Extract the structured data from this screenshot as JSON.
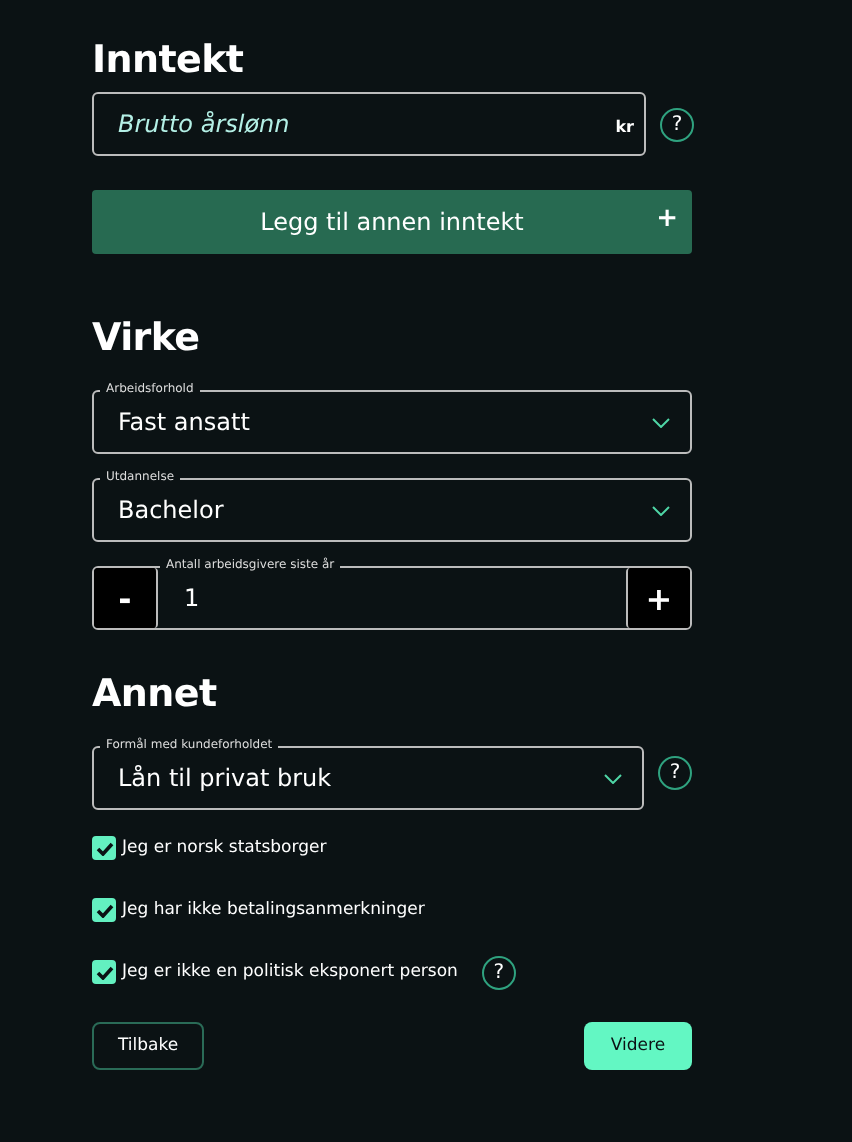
{
  "sections": [
    {
      "heading": "Inntekt",
      "fields": [
        {
          "kind": "input",
          "placeholder": "Brutto årslønn",
          "suffix": "kr",
          "help": "?"
        },
        {
          "kind": "add",
          "label": "Legg til annen inntekt",
          "icon": "+"
        }
      ]
    },
    {
      "heading": "Virke",
      "fields": [
        {
          "kind": "select",
          "legend": "Arbeidsforhold",
          "value": "Fast ansatt"
        },
        {
          "kind": "select",
          "legend": "Utdannelse",
          "value": "Bachelor"
        },
        {
          "kind": "stepper",
          "legend": "Antall arbeidsgivere siste år",
          "value": "1",
          "minus": "-",
          "plus": "+"
        }
      ]
    },
    {
      "heading": "Annet",
      "fields": [
        {
          "kind": "select",
          "legend": "Formål med kundeforholdet",
          "value": "Lån til privat bruk",
          "help": "?"
        },
        {
          "kind": "checkbox",
          "label": "Jeg er norsk statsborger",
          "checked": true
        },
        {
          "kind": "checkbox",
          "label": "Jeg har ikke betalingsanmerkninger",
          "checked": true
        },
        {
          "kind": "checkbox",
          "label": "Jeg er ikke en politisk eksponert person",
          "checked": true,
          "help": "?"
        }
      ]
    }
  ],
  "buttons": {
    "back": "Tilbake",
    "next": "Videre"
  }
}
